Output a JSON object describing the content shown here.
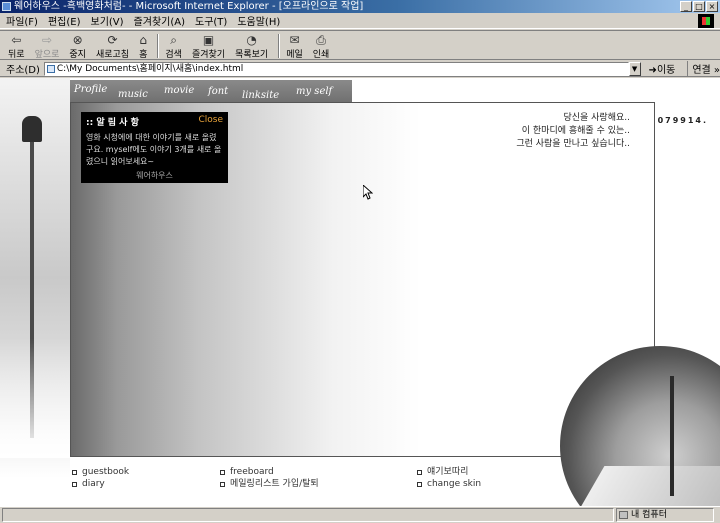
{
  "window": {
    "title": "웨어하우스 -흑백영화처럼- - Microsoft Internet Explorer - [오프라인으로 작업]",
    "buttons": [
      "_",
      "□",
      "×"
    ]
  },
  "menu": [
    "파일(F)",
    "편집(E)",
    "보기(V)",
    "즐겨찾기(A)",
    "도구(T)",
    "도움말(H)"
  ],
  "toolbar": {
    "back": "뒤로",
    "forward": "앞으로",
    "stop": "중지",
    "refresh": "새로고침",
    "home": "홈",
    "search": "검색",
    "favorites": "즐겨찾기",
    "history": "목록보기",
    "mail": "메일",
    "print": "인쇄"
  },
  "address": {
    "label": "주소(D)",
    "url": "C:\\My Documents\\홈페이지\\새홈\\index.html",
    "go": "이동",
    "links": "연결 »"
  },
  "nav": [
    "Profile",
    "music",
    "movie",
    "font",
    "linksite",
    "my self"
  ],
  "notice": {
    "heading": ":: 알 림 사 항",
    "close": "Close",
    "body": "영화 시청에에 대한 이야기를 새로 올렸구요. myself에도 이야기 3개를 새로 올렸으니 읽어보세요~",
    "sign": "웨어하우스"
  },
  "poem": [
    "당신을 사랑해요..",
    "이 한마디에 흥해줄 수 있는..",
    "그런 사람을 만나고 싶습니다.."
  ],
  "counter": "079914.",
  "links": {
    "col1": [
      "guestbook",
      "diary"
    ],
    "col2": [
      "freeboard",
      "메일링리스트 가입/탈퇴"
    ],
    "col3": [
      "얘기보따리",
      "change skin"
    ]
  },
  "status": {
    "zone": "내 컴퓨터"
  }
}
